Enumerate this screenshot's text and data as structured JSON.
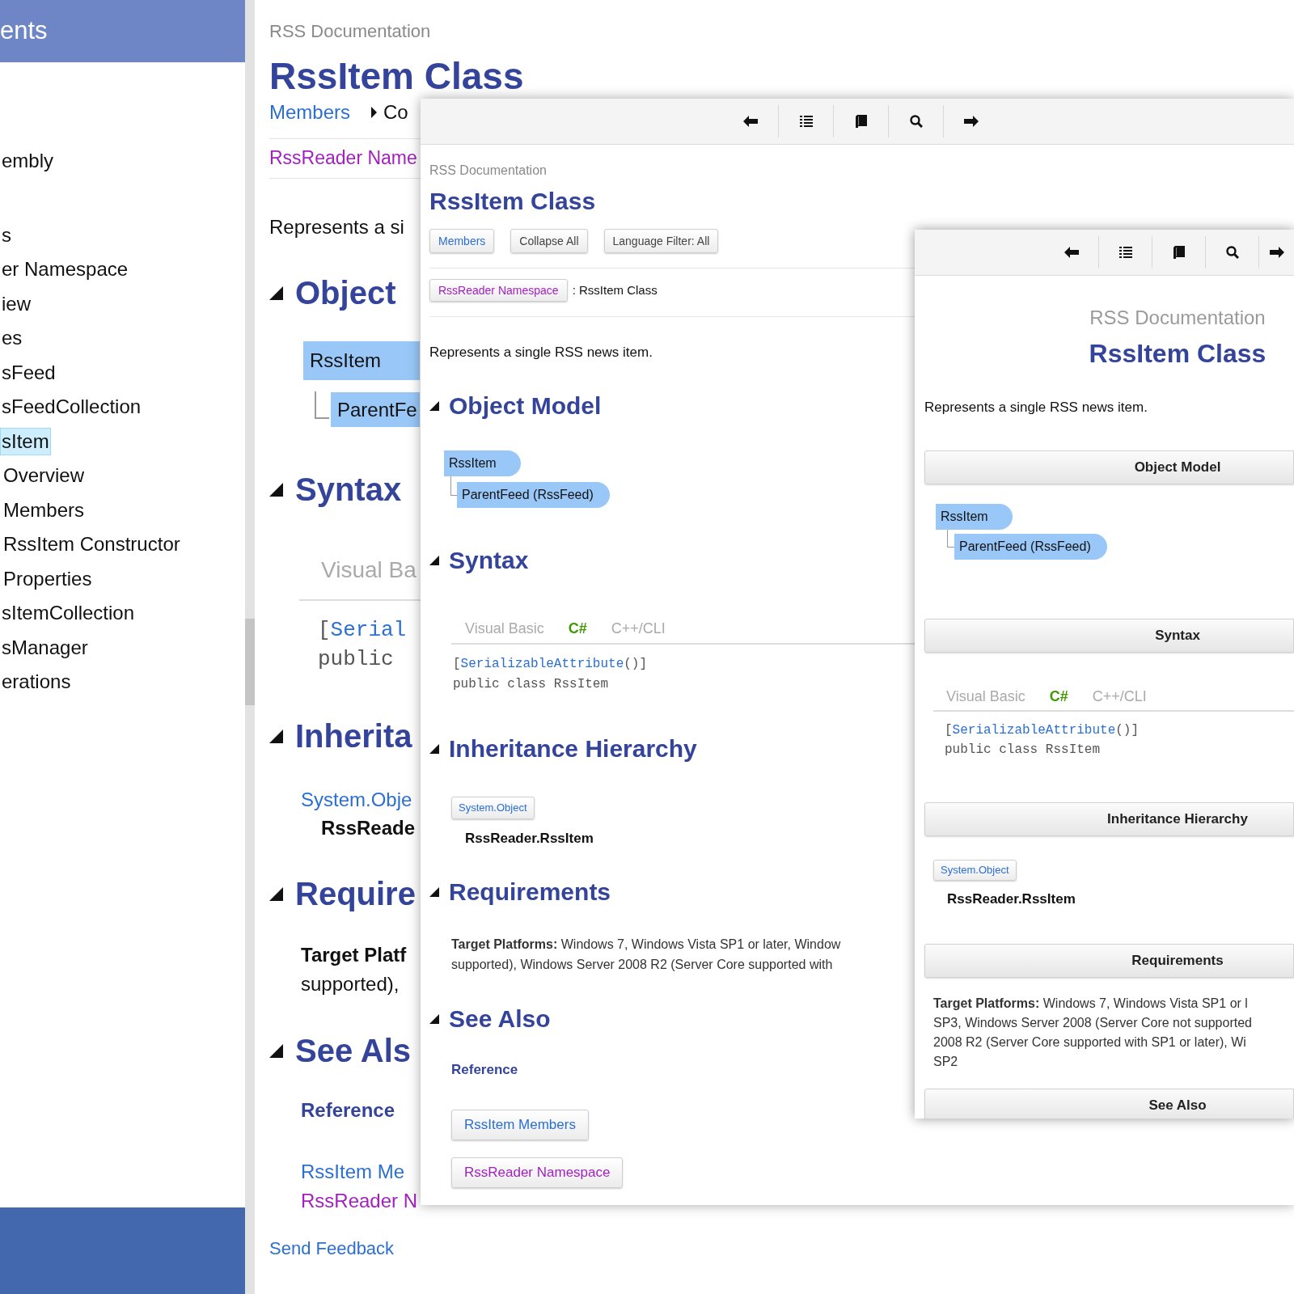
{
  "background_page": {
    "sidebar": {
      "header": "ents",
      "items": [
        {
          "label": "embly",
          "selected": false
        },
        {
          "label": "s",
          "selected": false
        },
        {
          "label": "er Namespace",
          "selected": false
        },
        {
          "label": "iew",
          "selected": false
        },
        {
          "label": "es",
          "selected": false
        },
        {
          "label": "sFeed",
          "selected": false
        },
        {
          "label": "sFeedCollection",
          "selected": false
        },
        {
          "label": "sItem",
          "selected": true,
          "children": [
            {
              "label": "Overview",
              "selected": false
            },
            {
              "label": "Members",
              "selected": false
            },
            {
              "label": "RssItem Constructor",
              "selected": false
            },
            {
              "label": "Properties",
              "selected": false
            }
          ]
        },
        {
          "label": "sItemCollection",
          "selected": false
        },
        {
          "label": "sManager",
          "selected": false
        },
        {
          "label": "erations",
          "selected": false
        }
      ]
    },
    "product": "RSS Documentation",
    "title": "RssItem Class",
    "nav": [
      {
        "label": "Members",
        "kind": "link"
      },
      {
        "label": "Co",
        "kind": "menu"
      }
    ],
    "breadcrumb": {
      "label": "RssReader Name",
      "visited": true
    },
    "summary": "Represents a si",
    "sections": [
      {
        "kind": "object_model",
        "heading": "Object",
        "expanded": true,
        "nodes": [
          {
            "label": "RssItem",
            "children": [
              {
                "label": "ParentFe"
              }
            ]
          }
        ]
      },
      {
        "kind": "syntax",
        "heading": "Syntax",
        "expanded": true,
        "tabs": [
          {
            "label": "Visual Ba",
            "selected": false
          }
        ],
        "code": [
          [
            {
              "text": "[",
              "kind": "plain"
            },
            {
              "text": "Serial",
              "kind": "type"
            }
          ],
          [
            {
              "text": "public",
              "kind": "plain"
            }
          ]
        ]
      },
      {
        "kind": "inheritance",
        "heading": "Inherita",
        "expanded": true,
        "base": {
          "label": "System.Obje",
          "visited": false
        },
        "current": "RssReade"
      },
      {
        "kind": "requirements",
        "heading": "Require",
        "expanded": true,
        "text": "**Target Platf**\nsupported),"
      },
      {
        "kind": "see_also",
        "heading": "See Als",
        "expanded": true,
        "subheading": "Reference",
        "links": [
          {
            "label": "RssItem Me",
            "visited": false
          },
          {
            "label": "RssReader N",
            "visited": true
          }
        ]
      }
    ],
    "footer_link": "Send Feedback"
  },
  "middle_window": {
    "product": "RSS Documentation",
    "title": "RssItem Class",
    "buttons": [
      {
        "label": "Members",
        "kind": "link"
      },
      {
        "label": "Collapse All",
        "kind": "action"
      },
      {
        "label": "Language Filter: All",
        "kind": "action"
      }
    ],
    "breadcrumb": {
      "link": {
        "label": "RssReader Namespace",
        "visited": true
      },
      "current": ": RssItem Class"
    },
    "summary": "Represents a single RSS news item.",
    "sections": [
      {
        "kind": "object_model",
        "heading": "Object Model",
        "expanded": true,
        "nodes": [
          {
            "label": "RssItem",
            "children": [
              {
                "label": "ParentFeed (RssFeed)"
              }
            ]
          }
        ]
      },
      {
        "kind": "syntax",
        "heading": "Syntax",
        "expanded": true,
        "tabs": [
          {
            "label": "Visual Basic",
            "selected": false
          },
          {
            "label": "C#",
            "selected": true
          },
          {
            "label": "C++/CLI",
            "selected": false
          }
        ],
        "code": [
          [
            {
              "text": "[",
              "kind": "plain"
            },
            {
              "text": "SerializableAttribute",
              "kind": "type"
            },
            {
              "text": "()]",
              "kind": "plain"
            }
          ],
          [
            {
              "text": "public class RssItem",
              "kind": "plain"
            }
          ]
        ]
      },
      {
        "kind": "inheritance",
        "heading": "Inheritance Hierarchy",
        "expanded": true,
        "base": {
          "label": "System.Object",
          "visited": false
        },
        "current": "RssReader.RssItem"
      },
      {
        "kind": "requirements",
        "heading": "Requirements",
        "expanded": true,
        "text": "**Target Platforms:** Windows 7, Windows Vista SP1 or later, Window\nsupported), Windows Server 2008 R2 (Server Core supported with"
      },
      {
        "kind": "see_also",
        "heading": "See Also",
        "expanded": true,
        "subheading": "Reference",
        "links": [
          {
            "label": "RssItem Members",
            "visited": false
          },
          {
            "label": "RssReader Namespace",
            "visited": true
          }
        ]
      }
    ]
  },
  "front_window": {
    "product": "RSS Documentation",
    "title": "RssItem Class",
    "summary": "Represents a single RSS news item.",
    "sections": [
      {
        "kind": "object_model",
        "heading": "Object Model",
        "nodes": [
          {
            "label": "RssItem",
            "children": [
              {
                "label": "ParentFeed (RssFeed)"
              }
            ]
          }
        ]
      },
      {
        "kind": "syntax",
        "heading": "Syntax",
        "tabs": [
          {
            "label": "Visual Basic",
            "selected": false
          },
          {
            "label": "C#",
            "selected": true
          },
          {
            "label": "C++/CLI",
            "selected": false
          }
        ],
        "code": [
          [
            {
              "text": "[",
              "kind": "plain"
            },
            {
              "text": "SerializableAttribute",
              "kind": "type"
            },
            {
              "text": "()]",
              "kind": "plain"
            }
          ],
          [
            {
              "text": "public class RssItem",
              "kind": "plain"
            }
          ]
        ]
      },
      {
        "kind": "inheritance",
        "heading": "Inheritance Hierarchy",
        "base": {
          "label": "System.Object",
          "visited": false
        },
        "current": "RssReader.RssItem"
      },
      {
        "kind": "requirements",
        "heading": "Requirements",
        "text": "**Target Platforms:** Windows 7, Windows Vista SP1 or l\nSP3, Windows Server 2008 (Server Core not supported\n2008 R2 (Server Core supported with SP1 or later), Wi\nSP2"
      },
      {
        "kind": "see_also",
        "heading": "See Also"
      }
    ]
  }
}
